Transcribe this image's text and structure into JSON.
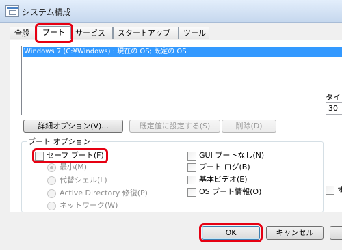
{
  "window": {
    "title": "システム構成"
  },
  "tabs": [
    {
      "label": "全般"
    },
    {
      "label": "ブート"
    },
    {
      "label": "サービス"
    },
    {
      "label": "スタートアップ"
    },
    {
      "label": "ツール"
    }
  ],
  "os_list": {
    "items": [
      "Windows 7 (C:¥Windows) : 現在の OS; 既定の OS"
    ]
  },
  "buttons": {
    "advanced": "詳細オプション(V)...",
    "set_default": "既定値に設定する(S)",
    "delete": "削除(D)",
    "ok": "OK",
    "cancel": "キャンセル"
  },
  "boot_options": {
    "group_label": "ブート オプション",
    "safe_boot": "セーフ ブート(F)",
    "radios": [
      "最小(M)",
      "代替シェル(L)",
      "Active Directory 修復(P)",
      "ネットワーク(W)"
    ],
    "checks": [
      "GUI ブートなし(N)",
      "ブート ログ(B)",
      "基本ビデオ(E)",
      "OS ブート情報(O)"
    ]
  },
  "timeout": {
    "label": "タイム",
    "value": "30"
  },
  "right_check": {
    "label": "す"
  }
}
